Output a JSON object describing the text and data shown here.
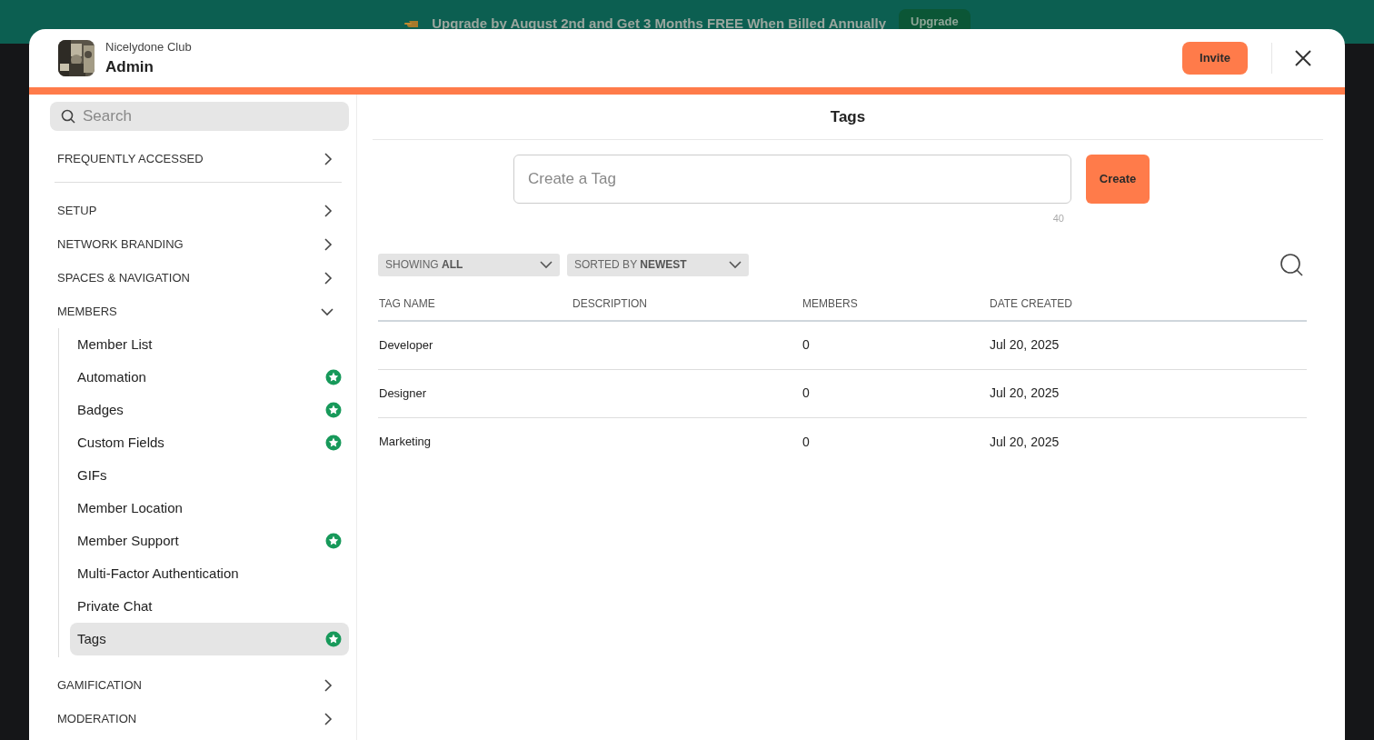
{
  "banner": {
    "text": "Upgrade by August 2nd and Get 3 Months FREE When Billed Annually",
    "button": "Upgrade"
  },
  "header": {
    "club": "Nicelydone Club",
    "title": "Admin",
    "invite": "Invite"
  },
  "sidebar": {
    "search_placeholder": "Search",
    "pinned": {
      "label": "FREQUENTLY ACCESSED",
      "expanded": false
    },
    "sections": [
      {
        "label": "SETUP",
        "expanded": false
      },
      {
        "label": "NETWORK BRANDING",
        "expanded": false
      },
      {
        "label": "SPACES & NAVIGATION",
        "expanded": false
      },
      {
        "label": "MEMBERS",
        "expanded": true,
        "children": [
          {
            "label": "Member List",
            "premium": false,
            "selected": false
          },
          {
            "label": "Automation",
            "premium": true,
            "selected": false
          },
          {
            "label": "Badges",
            "premium": true,
            "selected": false
          },
          {
            "label": "Custom Fields",
            "premium": true,
            "selected": false
          },
          {
            "label": "GIFs",
            "premium": false,
            "selected": false
          },
          {
            "label": "Member Location",
            "premium": false,
            "selected": false
          },
          {
            "label": "Member Support",
            "premium": true,
            "selected": false
          },
          {
            "label": "Multi-Factor Authentication",
            "premium": false,
            "selected": false
          },
          {
            "label": "Private Chat",
            "premium": false,
            "selected": false
          },
          {
            "label": "Tags",
            "premium": true,
            "selected": true
          }
        ]
      },
      {
        "label": "GAMIFICATION",
        "expanded": false
      },
      {
        "label": "MODERATION",
        "expanded": false
      }
    ]
  },
  "main": {
    "title": "Tags",
    "input_placeholder": "Create a Tag",
    "create": "Create",
    "counter": "40",
    "filters": [
      {
        "prefix": "SHOWING",
        "value": "ALL"
      },
      {
        "prefix": "SORTED BY",
        "value": "NEWEST"
      }
    ],
    "table": {
      "columns": [
        "TAG NAME",
        "DESCRIPTION",
        "MEMBERS",
        "DATE CREATED"
      ],
      "rows": [
        {
          "name": "Developer",
          "members": "0",
          "date": "Jul 20, 2025"
        },
        {
          "name": "Designer",
          "members": "0",
          "date": "Jul 20, 2025"
        },
        {
          "name": "Marketing",
          "members": "0",
          "date": "Jul 20, 2025"
        }
      ]
    }
  }
}
